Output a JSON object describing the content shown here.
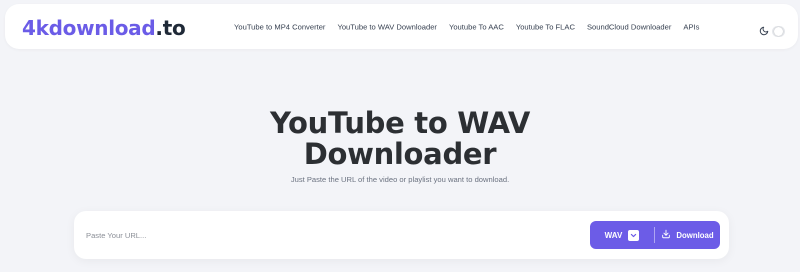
{
  "navbar": {
    "logo_brand": "4kdownload",
    "logo_tld": ".to",
    "links": [
      "YouTube to MP4 Converter",
      "YouTube to WAV Downloader",
      "Youtube To AAC",
      "Youtube To FLAC",
      "SoundCloud Downloader",
      "APIs"
    ],
    "theme_icon": "moon-icon"
  },
  "hero": {
    "title_line1": "YouTube to WAV",
    "title_line2": "Downloader",
    "subtitle": "Just Paste the URL of the video or playlist you want to download."
  },
  "search": {
    "placeholder": "Paste Your URL...",
    "value": "",
    "format_selected": "WAV",
    "download_label": "Download"
  },
  "colors": {
    "accent": "#6c5ce7",
    "background": "#f3f4f8",
    "title_text": "#2c2f33"
  }
}
